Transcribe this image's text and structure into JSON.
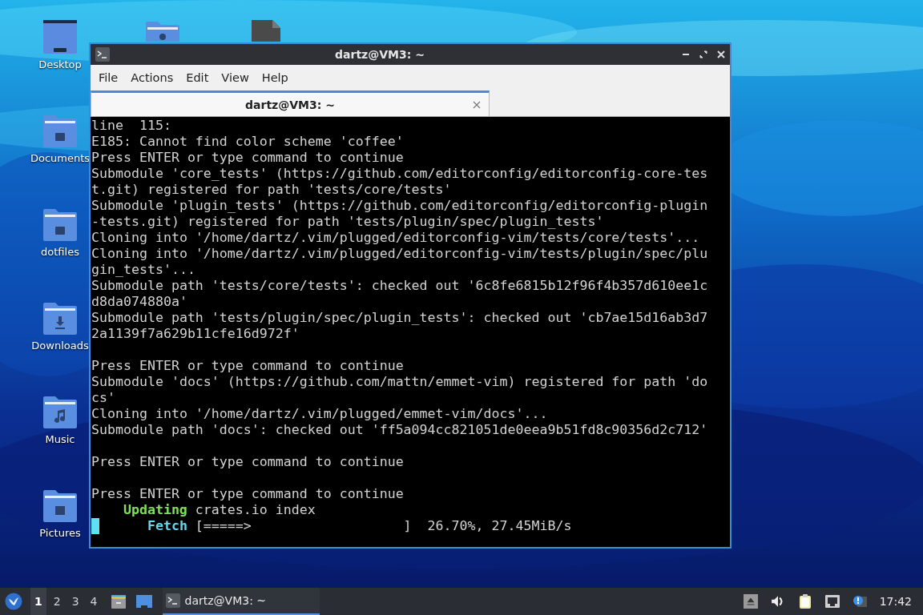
{
  "desktop_icons": [
    {
      "kind": "desktop",
      "label": "Desktop"
    },
    {
      "kind": "folder",
      "label": "Documents"
    },
    {
      "kind": "folder",
      "label": "dotfiles"
    },
    {
      "kind": "downloads",
      "label": "Downloads"
    },
    {
      "kind": "music",
      "label": "Music"
    },
    {
      "kind": "pictures",
      "label": "Pictures"
    },
    {
      "kind": "home"
    },
    {
      "kind": "file"
    }
  ],
  "window": {
    "title": "dartz@VM3: ~",
    "menu": [
      "File",
      "Actions",
      "Edit",
      "View",
      "Help"
    ],
    "tabs": [
      {
        "label": "dartz@VM3: ~",
        "selected": true
      }
    ],
    "terminal": {
      "lines": [
        {
          "kind": "text",
          "text": "line  115:"
        },
        {
          "kind": "text",
          "text": "E185: Cannot find color scheme 'coffee'"
        },
        {
          "kind": "text",
          "text": "Press ENTER or type command to continue"
        },
        {
          "kind": "text",
          "text": "Submodule 'core_tests' (https://github.com/editorconfig/editorconfig-core-tes"
        },
        {
          "kind": "text",
          "text": "t.git) registered for path 'tests/core/tests'"
        },
        {
          "kind": "text",
          "text": "Submodule 'plugin_tests' (https://github.com/editorconfig/editorconfig-plugin"
        },
        {
          "kind": "text",
          "text": "-tests.git) registered for path 'tests/plugin/spec/plugin_tests'"
        },
        {
          "kind": "text",
          "text": "Cloning into '/home/dartz/.vim/plugged/editorconfig-vim/tests/core/tests'..."
        },
        {
          "kind": "text",
          "text": "Cloning into '/home/dartz/.vim/plugged/editorconfig-vim/tests/plugin/spec/plu"
        },
        {
          "kind": "text",
          "text": "gin_tests'..."
        },
        {
          "kind": "text",
          "text": "Submodule path 'tests/core/tests': checked out '6c8fe6815b12f96f4b357d610ee1c"
        },
        {
          "kind": "text",
          "text": "d8da074880a'"
        },
        {
          "kind": "text",
          "text": "Submodule path 'tests/plugin/spec/plugin_tests': checked out 'cb7ae15d16ab3d7"
        },
        {
          "kind": "text",
          "text": "2a1139f7a629b11cfe16d972f'"
        },
        {
          "kind": "blank"
        },
        {
          "kind": "text",
          "text": "Press ENTER or type command to continue"
        },
        {
          "kind": "text",
          "text": "Submodule 'docs' (https://github.com/mattn/emmet-vim) registered for path 'do"
        },
        {
          "kind": "text",
          "text": "cs'"
        },
        {
          "kind": "text",
          "text": "Cloning into '/home/dartz/.vim/plugged/emmet-vim/docs'..."
        },
        {
          "kind": "text",
          "text": "Submodule path 'docs': checked out 'ff5a094cc821051de0eea9b51fd8c90356d2c712'"
        },
        {
          "kind": "blank"
        },
        {
          "kind": "text",
          "text": "Press ENTER or type command to continue"
        },
        {
          "kind": "blank"
        },
        {
          "kind": "text",
          "text": "Press ENTER or type command to continue"
        },
        {
          "kind": "status",
          "label": "Updating",
          "color": "#7ee05a",
          "text": "crates.io index",
          "cursor": false
        },
        {
          "kind": "status",
          "label": "Fetch",
          "color": "#62d8f0",
          "text": "[=====>                   ]  26.70%, 27.45MiB/s",
          "cursor": true
        }
      ]
    }
  },
  "taskbar": {
    "workspaces": [
      {
        "label": "1",
        "selected": true
      },
      {
        "label": "2",
        "selected": false
      },
      {
        "label": "3",
        "selected": false
      },
      {
        "label": "4",
        "selected": false
      }
    ],
    "tasks": [
      {
        "label": "dartz@VM3: ~",
        "selected": true
      }
    ],
    "clock": "17:42"
  }
}
